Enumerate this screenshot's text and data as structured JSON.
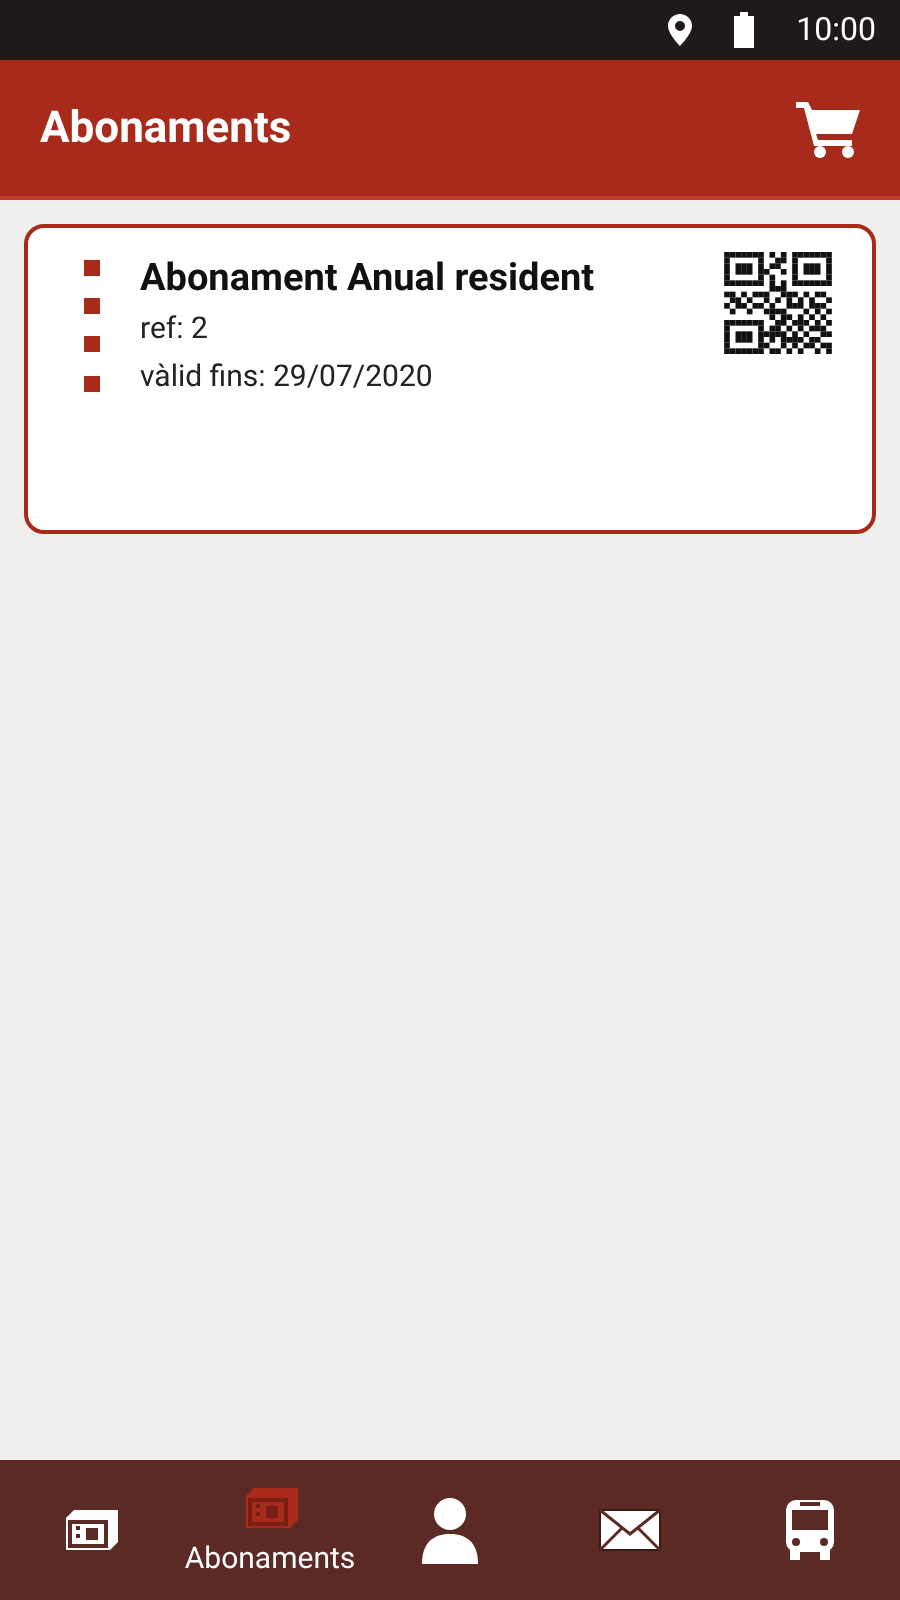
{
  "status_bar": {
    "time": "10:00"
  },
  "app_bar": {
    "title": "Abonaments"
  },
  "passes": [
    {
      "title": "Abonament Anual resident",
      "ref": "ref: 2",
      "valid_until": "vàlid fins: 29/07/2020"
    }
  ],
  "bottom_nav": [
    {
      "kind": "ticket",
      "selected": false
    },
    {
      "kind": "pass",
      "selected": true,
      "label": "Abonaments"
    },
    {
      "kind": "user",
      "selected": false
    },
    {
      "kind": "mail",
      "selected": false
    },
    {
      "kind": "bus",
      "selected": false
    }
  ]
}
